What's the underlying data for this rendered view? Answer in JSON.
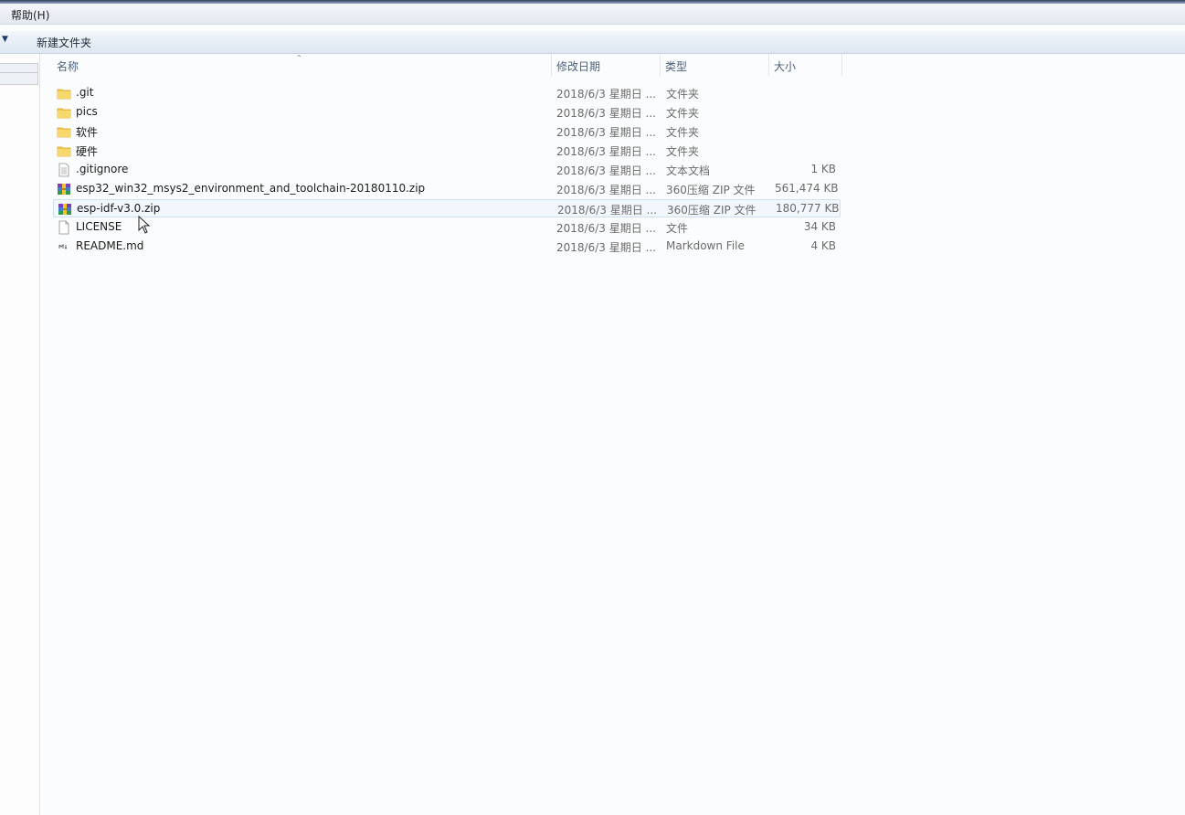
{
  "menubar": {
    "help_label": "帮助(H)"
  },
  "toolbar": {
    "new_folder_label": "新建文件夹"
  },
  "columns": {
    "name": "名称",
    "modified": "修改日期",
    "type": "类型",
    "size": "大小"
  },
  "files": [
    {
      "name": ".git",
      "modified": "2018/6/3 星期日 ...",
      "type": "文件夹",
      "size": "",
      "icon": "folder-icon"
    },
    {
      "name": "pics",
      "modified": "2018/6/3 星期日 ...",
      "type": "文件夹",
      "size": "",
      "icon": "folder-icon"
    },
    {
      "name": "软件",
      "modified": "2018/6/3 星期日 ...",
      "type": "文件夹",
      "size": "",
      "icon": "folder-icon"
    },
    {
      "name": "硬件",
      "modified": "2018/6/3 星期日 ...",
      "type": "文件夹",
      "size": "",
      "icon": "folder-icon"
    },
    {
      "name": ".gitignore",
      "modified": "2018/6/3 星期日 ...",
      "type": "文本文档",
      "size": "1 KB",
      "icon": "text-file-icon"
    },
    {
      "name": "esp32_win32_msys2_environment_and_toolchain-20180110.zip",
      "modified": "2018/6/3 星期日 ...",
      "type": "360压缩 ZIP 文件",
      "size": "561,474 KB",
      "icon": "zip-archive-icon"
    },
    {
      "name": "esp-idf-v3.0.zip",
      "modified": "2018/6/3 星期日 ...",
      "type": "360压缩 ZIP 文件",
      "size": "180,777 KB",
      "icon": "zip-archive-icon"
    },
    {
      "name": "LICENSE",
      "modified": "2018/6/3 星期日 ...",
      "type": "文件",
      "size": "34 KB",
      "icon": "blank-file-icon"
    },
    {
      "name": "README.md",
      "modified": "2018/6/3 星期日 ...",
      "type": "Markdown File",
      "size": "4 KB",
      "icon": "markdown-file-icon"
    }
  ],
  "colors": {
    "folder": "#f2c84b",
    "header_text": "#4c607a",
    "selection_border": "#cfe0f2"
  }
}
